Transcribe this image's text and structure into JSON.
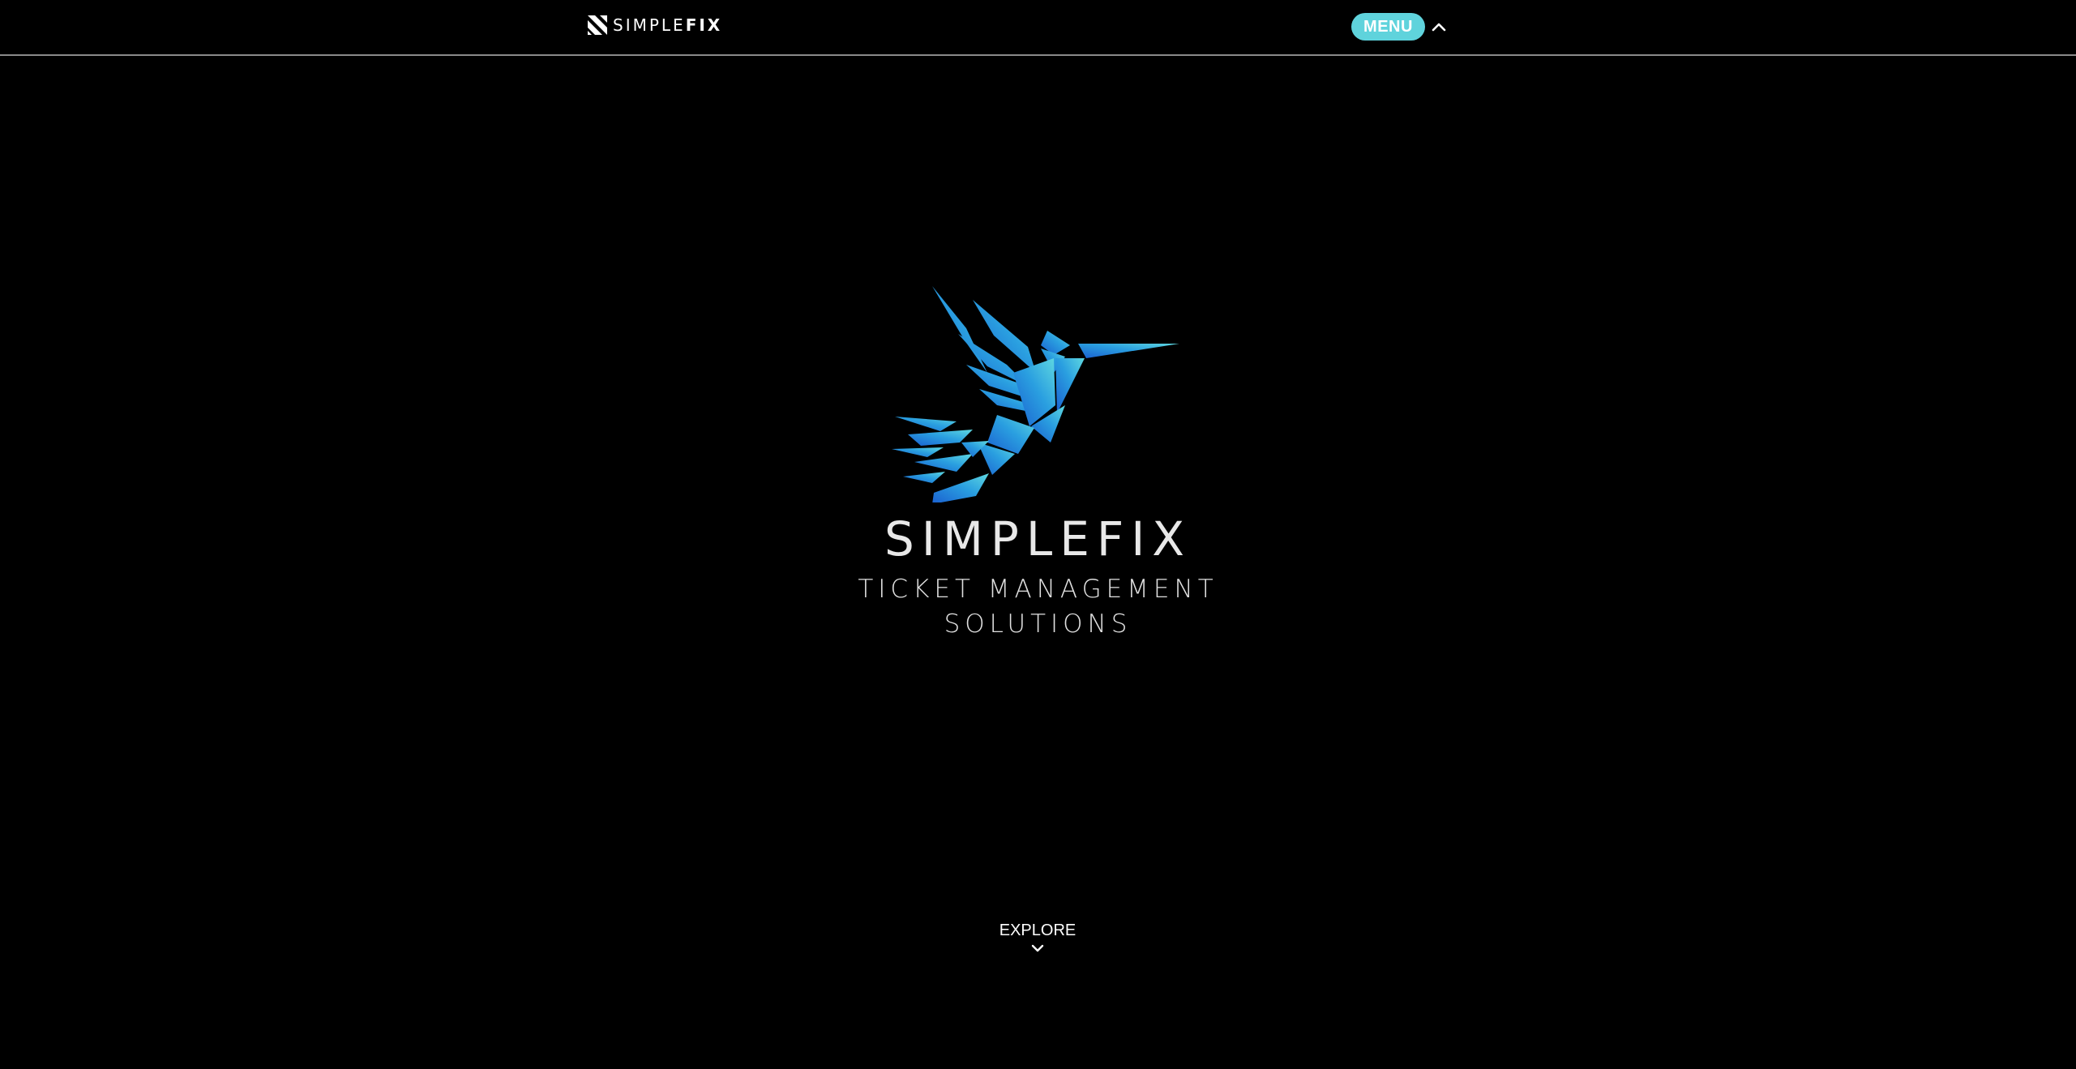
{
  "nav": {
    "logo_light": "SIMPLE",
    "logo_bold": "FIX",
    "menu_label": "MENU"
  },
  "hero": {
    "title": "SIMPLEFIX",
    "subtitle_line1": "TICKET MANAGEMENT",
    "subtitle_line2": "SOLUTIONS"
  },
  "explore": {
    "label": "EXPLORE"
  },
  "colors": {
    "background": "#000000",
    "accent": "#5fd3dc",
    "bird_light": "#5fd8e0",
    "bird_dark": "#1a5fd0",
    "divider": "#8a8a8a"
  },
  "icons": {
    "nav_logo": "simplefix-mark-icon",
    "menu_toggle": "chevron-up-icon",
    "explore_arrow": "chevron-down-icon",
    "hero_logo": "hummingbird-logo"
  }
}
